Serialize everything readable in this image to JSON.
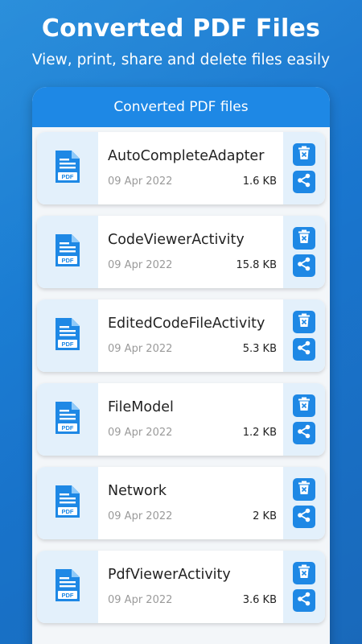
{
  "promo": {
    "title": "Converted PDF Files",
    "subtitle": "View, print, share and delete files easily"
  },
  "app": {
    "title": "Converted PDF files",
    "accent": "#1e88e5",
    "thumb_bg": "#e3f0fb"
  },
  "files": [
    {
      "name": "AutoCompleteAdapter",
      "date": "09 Apr 2022",
      "size": "1.6 KB"
    },
    {
      "name": "CodeViewerActivity",
      "date": "09 Apr 2022",
      "size": "15.8 KB"
    },
    {
      "name": "EditedCodeFileActivity",
      "date": "09 Apr 2022",
      "size": "5.3 KB"
    },
    {
      "name": "FileModel",
      "date": "09 Apr 2022",
      "size": "1.2 KB"
    },
    {
      "name": "Network",
      "date": "09 Apr 2022",
      "size": "2 KB"
    },
    {
      "name": "PdfViewerActivity",
      "date": "09 Apr 2022",
      "size": "3.6 KB"
    }
  ],
  "icons": {
    "file": "pdf-file-icon",
    "delete": "delete-icon",
    "share": "share-icon"
  }
}
